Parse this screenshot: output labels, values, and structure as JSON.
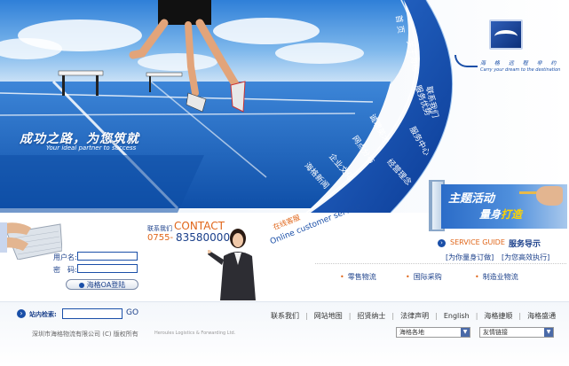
{
  "hero": {
    "slogan_main": "成功之路，为您筑就",
    "slogan_sub": "Your ideal partner to success"
  },
  "logo": {
    "name_cn": "海 格 远 程 非 约",
    "tagline": "Carry your dream to the destination"
  },
  "menu": {
    "items": [
      {
        "label": "首 页"
      },
      {
        "label": "关于海格"
      },
      {
        "label": "服务优势"
      },
      {
        "label": "服务中心"
      },
      {
        "label": "经营理念"
      },
      {
        "label": "联系我们"
      },
      {
        "label": "诚聘英才"
      },
      {
        "label": "网点分布"
      },
      {
        "label": "企业文化"
      },
      {
        "label": "海格新闻"
      }
    ]
  },
  "theme": {
    "title": "主题活动",
    "subtitle_a": "量身",
    "subtitle_b": "打造"
  },
  "service_guide": {
    "label_en": "SERVICE GUIDE",
    "label_cn": "服务导示",
    "links": [
      "[为你量身订做]",
      "[为您高效执行]"
    ]
  },
  "services": [
    "零售物流",
    "国际采购",
    "制造业物流"
  ],
  "login": {
    "username_label": "用户名:",
    "password_label": "密　码:",
    "oa_button": "海格OA登陆"
  },
  "contact": {
    "label": "联系我们",
    "title": "CONTACT",
    "area_code": "0755-",
    "phone": "83580000"
  },
  "online": {
    "label_cn": "在线客服",
    "label_en": "Online customer service"
  },
  "footer": {
    "search_label": "站内检索:",
    "go": "GO",
    "nav": [
      "联系我们",
      "网站地图",
      "招贤纳士",
      "法律声明",
      "English",
      "海格捷顺",
      "海格盛通"
    ],
    "copyright_cn": "深圳市海格物流有限公司 (C) 版权所有",
    "copyright_en": "Heroules Logistics & Forwarding Ltd.",
    "select_regions": "海格各地",
    "select_links": "友情链接"
  },
  "colors": {
    "brand_blue": "#1a4fa8",
    "accent_orange": "#e0661a"
  }
}
